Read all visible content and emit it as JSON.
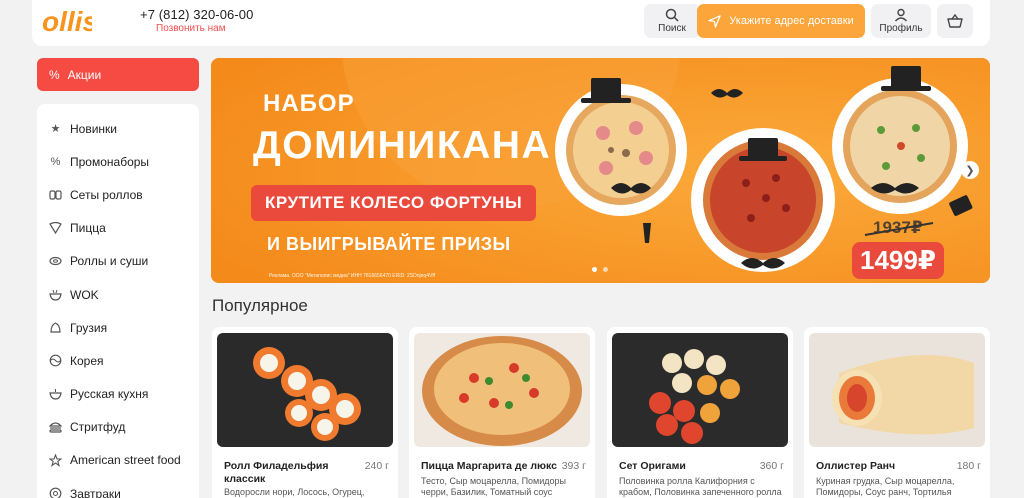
{
  "header": {
    "phone": "+7 (812) 320-06-00",
    "call_me": "Позвонить нам",
    "search_label": "Поиск",
    "delivery_label": "Укажите адрес доставки",
    "profile_label": "Профиль",
    "brand_color": "#fba53a"
  },
  "sidebar": {
    "promo": "Акции",
    "items": [
      {
        "label": "Новинки",
        "icon": "star-icon"
      },
      {
        "label": "Промонаборы",
        "icon": "percent-icon"
      },
      {
        "label": "Сеты роллов",
        "icon": "roll-set-icon"
      },
      {
        "label": "Пицца",
        "icon": "pizza-icon"
      },
      {
        "label": "Роллы и суши",
        "icon": "sushi-icon"
      },
      {
        "label": "WOK",
        "icon": "wok-icon"
      },
      {
        "label": "Грузия",
        "icon": "georgia-icon"
      },
      {
        "label": "Корея",
        "icon": "korea-icon"
      },
      {
        "label": "Русская кухня",
        "icon": "russian-dish-icon"
      },
      {
        "label": "Стритфуд",
        "icon": "burger-icon"
      },
      {
        "label": "American street food",
        "icon": "us-star-icon"
      },
      {
        "label": "Завтраки",
        "icon": "breakfast-icon"
      }
    ]
  },
  "banner": {
    "line1": "НАБОР",
    "line2": "ДОМИНИКАНА",
    "pill": "КРУТИТЕ КОЛЕСО ФОРТУНЫ",
    "line3": "И ВЫИГРЫВАЙТЕ ПРИЗЫ",
    "legal": "Реклама. ООО \"Мегаполис медиа\" ИНН 7816656470 ERID: 2SDnjeq4Vff",
    "old_price": "1937₽",
    "new_price": "1499₽"
  },
  "popular": {
    "title": "Популярное",
    "cards": [
      {
        "name": "Ролл Филадельфия классик",
        "weight": "240 г",
        "desc": "Водоросли нори, Лосось, Огурец,"
      },
      {
        "name": "Пицца Маргарита де люкс",
        "weight": "393 г",
        "desc": "Тесто, Сыр моцарелла, Помидоры черри, Базилик, Томатный соус"
      },
      {
        "name": "Сет Оригами",
        "weight": "360 г",
        "desc": "Половинка ролла Калифорния с крабом, Половинка запеченного ролла с крабом Кидо, Половинка хрустящего"
      },
      {
        "name": "Оллистер Ранч",
        "weight": "180 г",
        "desc": "Куриная грудка, Сыр моцарелла, Помидоры, Соус ранч, Тортилья пшеничная"
      }
    ]
  }
}
